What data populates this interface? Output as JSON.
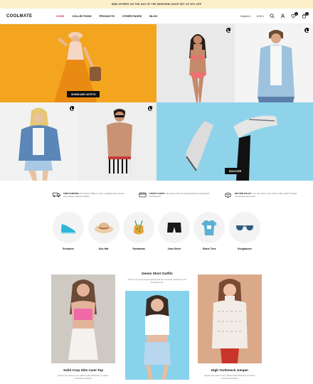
{
  "announcement": "NEW OFFERS ON THE DAY OF THE WEEKEND SHOP GET UP 40% OFF",
  "brand": "COOLMATE",
  "nav": [
    "HOME",
    "COLLECTIONS",
    "PRODUCTS",
    "OTHER PAGES",
    "BLOG"
  ],
  "utils": {
    "language": "English",
    "currency": "USD",
    "wishlist_count": "0",
    "cart_count": "0"
  },
  "hero": {
    "cta_left": "SHOWCASE OUTFITS",
    "cta_right": "DISCOVER"
  },
  "features": [
    {
      "title": "FREE SHIPPING",
      "text": ": All orders of $49 or more of eligible items across any product category qualify."
    },
    {
      "title": "CREDIT CARDS",
      "text": ": We accept Visa, American Express, Mastercard, and Discover."
    },
    {
      "title": "RETURN POLICY",
      "text": ": You can return most online orders within 30 days of receiving your order."
    }
  ],
  "categories": [
    "Sneakers",
    "Sun Hat",
    "Swimwear",
    "Jean Short",
    "Basic Tees",
    "Sunglasses"
  ],
  "products": {
    "middle_title": "Denim Short Outfits",
    "middle_desc": "See our top picks for jean jackets that are oversized, distressed, and downright cool.",
    "left_title": "Solid Crop Slim Cami Top",
    "left_desc": "Explore the season's top crafted styles defined by a modern Americana aesthetic.",
    "right_title": "High Turtleneck Jumper",
    "right_desc": "Explore the season's top crafted styles defined by a modern Americana aesthetic."
  },
  "colors": {
    "accent": "#d93c6a",
    "banner": "#fbf0c9",
    "orange": "#f3a51f",
    "sky": "#8fd3ea"
  }
}
